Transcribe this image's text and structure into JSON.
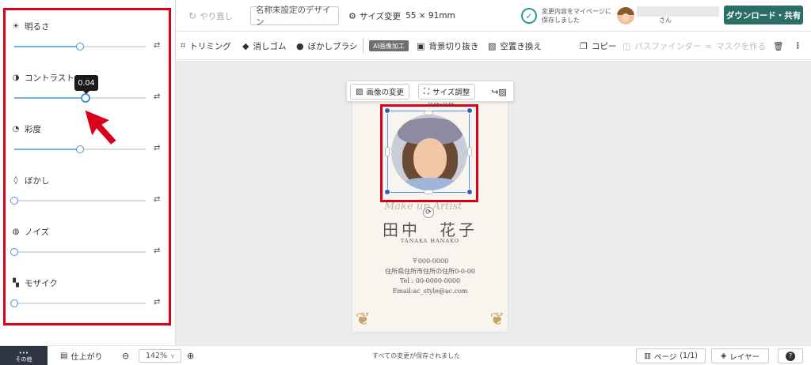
{
  "topbar": {
    "undo_icon": "redo-icon",
    "undo_label": "やり直し",
    "design_name": "名称未設定のデザイン",
    "size_change_icon": "gear-icon",
    "size_change_label": "サイズ変更",
    "size_value": "55 × 91mm",
    "save_status_line1": "変更内容をマイページに",
    "save_status_line2": "保存しました",
    "user_suffix": "さん",
    "download_label": "ダウンロード・共有",
    "accent_color": "#2b6e68"
  },
  "toolbar": {
    "trim": "トリミング",
    "eraser": "消しゴム",
    "blur_brush": "ぼかしブラシ",
    "ai_badge": "AI画像加工",
    "bg_remove": "背景切り抜き",
    "sky_replace": "空置き換え",
    "copy": "コピー",
    "pathfinder": "パスファインダー",
    "mask": "マスクを作る"
  },
  "adjustments": [
    {
      "label": "明るさ",
      "icon": "brightness-icon",
      "value": 0.5
    },
    {
      "label": "コントラスト",
      "icon": "contrast-icon",
      "value": 0.54
    },
    {
      "label": "彩度",
      "icon": "saturation-icon",
      "value": 0.5
    },
    {
      "label": "ぼかし",
      "icon": "blur-drop-icon",
      "value": 0
    },
    {
      "label": "ノイズ",
      "icon": "noise-icon",
      "value": 0
    },
    {
      "label": "モザイク",
      "icon": "mosaic-icon",
      "value": 0
    }
  ],
  "tooltip_value": "0.04",
  "image_toolbar": {
    "change_image": "画像の変更",
    "resize": "サイズ調整"
  },
  "card": {
    "script_text": "Make up Artist",
    "name": "田中　花子",
    "romaji": "TANAKA HANAKO",
    "postal": "〒000-0000",
    "address": "住所県住所市住所の住所0-0-00",
    "tel": "Tel : 00-0000-0000",
    "email": "Email:ac_style@ac.com",
    "size_readout": "27.58×27.58"
  },
  "bottombar": {
    "others_label": "その他",
    "finish_label": "仕上がり",
    "zoom_value": "142%",
    "saved_message": "すべての変更が保存されました",
    "page_label": "ページ",
    "page_count": "(1/1)",
    "layer_label": "レイヤー"
  },
  "colors": {
    "highlight_red": "#d9001b",
    "slider_blue": "#4a90d9",
    "ornament_gold": "#c8a464"
  }
}
